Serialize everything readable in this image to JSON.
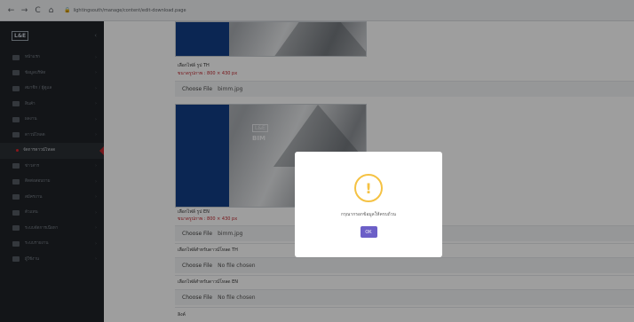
{
  "browser": {
    "url": "lightingsouth/manage/content/edit-download.page"
  },
  "sidebar": {
    "logo": "L&E",
    "items": [
      {
        "label": "หน้าแรก"
      },
      {
        "label": "ข้อมูลบริษัท"
      },
      {
        "label": "สมาชิก / ผู้ดูแล"
      },
      {
        "label": "สินค้า"
      },
      {
        "label": "ผลงาน"
      },
      {
        "label": "ดาวน์โหลด"
      },
      {
        "label": "จัดการดาวน์โหลด",
        "sub": true,
        "active": true
      },
      {
        "label": "ข่าวสาร"
      },
      {
        "label": "ติดต่อสอบถาม"
      },
      {
        "label": "สมัครงาน"
      },
      {
        "label": "ตัวแทน"
      },
      {
        "label": "ระบบจัดการเนื้อหา"
      },
      {
        "label": "ระบบรายงาน"
      },
      {
        "label": "ผู้ใช้งาน"
      }
    ]
  },
  "content": {
    "img_th_label": "เลือกไฟล์ รูป TH",
    "img_en_label": "เลือกไฟล์ รูป EN",
    "size_hint": "ขนาดรูปภาพ : 800 × 430 px",
    "choose_file": "Choose File",
    "file_bimm": "bimm.jpg",
    "file_th_label": "เลือกไฟล์สำหรับดาวน์โหลด TH",
    "file_en_label": "เลือกไฟล์สำหรับดาวน์โหลด EN",
    "no_file": "No file chosen",
    "next_label": "ลิงค์",
    "banner_text": "BIM",
    "banner_logo": "L&E"
  },
  "modal": {
    "icon": "!",
    "message": "กรุณากรอกข้อมูลให้ครบถ้วน",
    "ok_label": "OK"
  }
}
